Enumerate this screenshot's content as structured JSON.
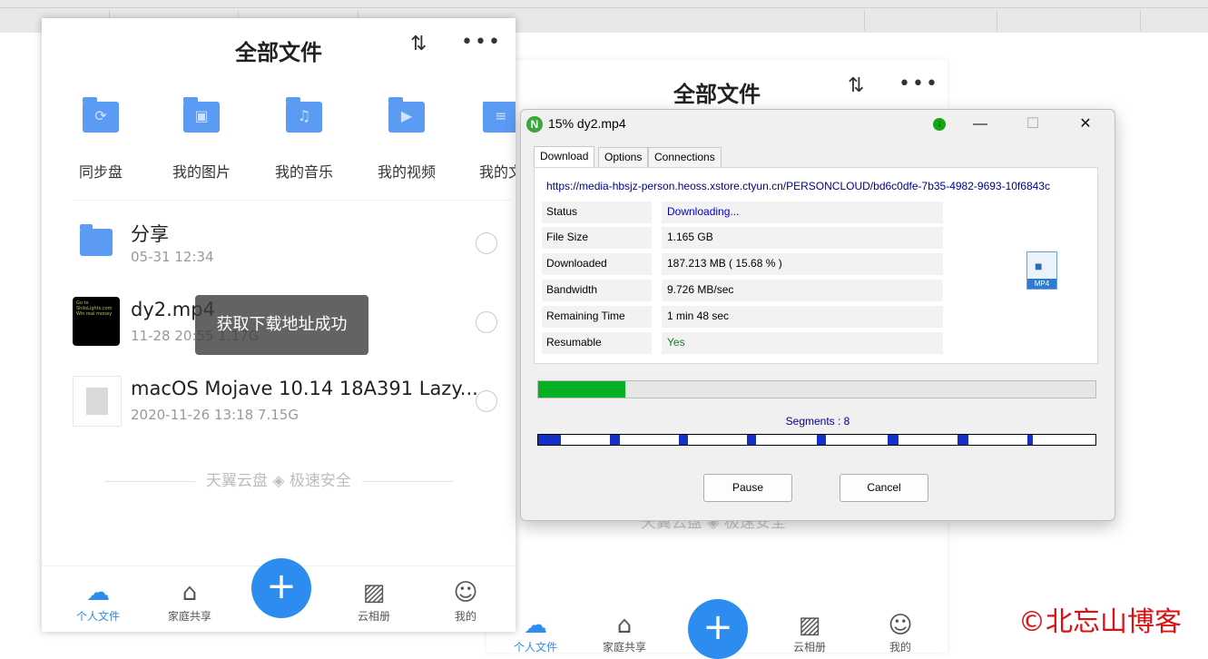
{
  "cloud": {
    "title": "全部文件",
    "sort_icon": "⇅",
    "more_icon": "•••",
    "folders": [
      {
        "label": "同步盘",
        "icon": "sync-icon",
        "glyph": "⟳"
      },
      {
        "label": "我的图片",
        "icon": "image-icon",
        "glyph": "▣"
      },
      {
        "label": "我的音乐",
        "icon": "music-icon",
        "glyph": "♫"
      },
      {
        "label": "我的视频",
        "icon": "video-icon",
        "glyph": "▶"
      },
      {
        "label": "我的文",
        "icon": "document-icon",
        "glyph": "≡"
      }
    ],
    "files": [
      {
        "name": "分享",
        "meta": "05-31 12:34"
      },
      {
        "name": "dy2.mp4",
        "meta": "11-28 20:55    1.17G",
        "thumb_text": "Go to ShiloLights.com Win real money"
      },
      {
        "name": "macOS Mojave 10.14 18A391 Lazy...",
        "meta": "2020-11-26 13:18    7.15G"
      }
    ],
    "toast": "获取下载地址成功",
    "footer": "天翼云盘 ◈ 极速安全",
    "tabs": [
      {
        "label": "个人文件",
        "glyph": "☁"
      },
      {
        "label": "家庭共享",
        "glyph": "⌂"
      },
      {
        "label": "云相册",
        "glyph": "▨"
      },
      {
        "label": "我的",
        "glyph": "☺"
      }
    ],
    "fab": "+"
  },
  "background_panel": {
    "title": "全部文件",
    "footer": "天翼云盘 ◈ 极速安全",
    "tabs": [
      {
        "label": "个人文件",
        "glyph": "☁"
      },
      {
        "label": "家庭共享",
        "glyph": "⌂"
      },
      {
        "label": "云相册",
        "glyph": "▨"
      },
      {
        "label": "我的",
        "glyph": "☺"
      }
    ]
  },
  "download": {
    "window_title": "15%  dy2.mp4",
    "app_icon": "N",
    "tabs": [
      "Download",
      "Options",
      "Connections"
    ],
    "url": "https://media-hbsjz-person.heoss.xstore.ctyun.cn/PERSONCLOUD/bd6c0dfe-7b35-4982-9693-10f6843c",
    "fields": [
      {
        "key": "Status",
        "value": "Downloading...",
        "color": "#0000cc"
      },
      {
        "key": "File Size",
        "value": "1.165 GB",
        "color": "#000000"
      },
      {
        "key": "Downloaded",
        "value": "187.213 MB ( 15.68 % )",
        "color": "#000000"
      },
      {
        "key": "Bandwidth",
        "value": "9.726 MB/sec",
        "color": "#000000"
      },
      {
        "key": "Remaining Time",
        "value": "1 min  48 sec",
        "color": "#000000"
      },
      {
        "key": "Resumable",
        "value": "Yes",
        "color": "#1a7a1a"
      }
    ],
    "file_ext": "MP4",
    "progress": 0.1568,
    "segments_label": "Segments : 8",
    "segments": [
      0.04,
      0.018,
      0.016,
      0.016,
      0.016,
      0.02,
      0.02,
      0.01
    ],
    "segment_starts": [
      0.0,
      0.128,
      0.252,
      0.375,
      0.5,
      0.627,
      0.752,
      0.878
    ],
    "pause": "Pause",
    "cancel": "Cancel",
    "accent_green": "#06b025",
    "segment_color": "#1430c7"
  },
  "watermark": "©北忘山博客"
}
